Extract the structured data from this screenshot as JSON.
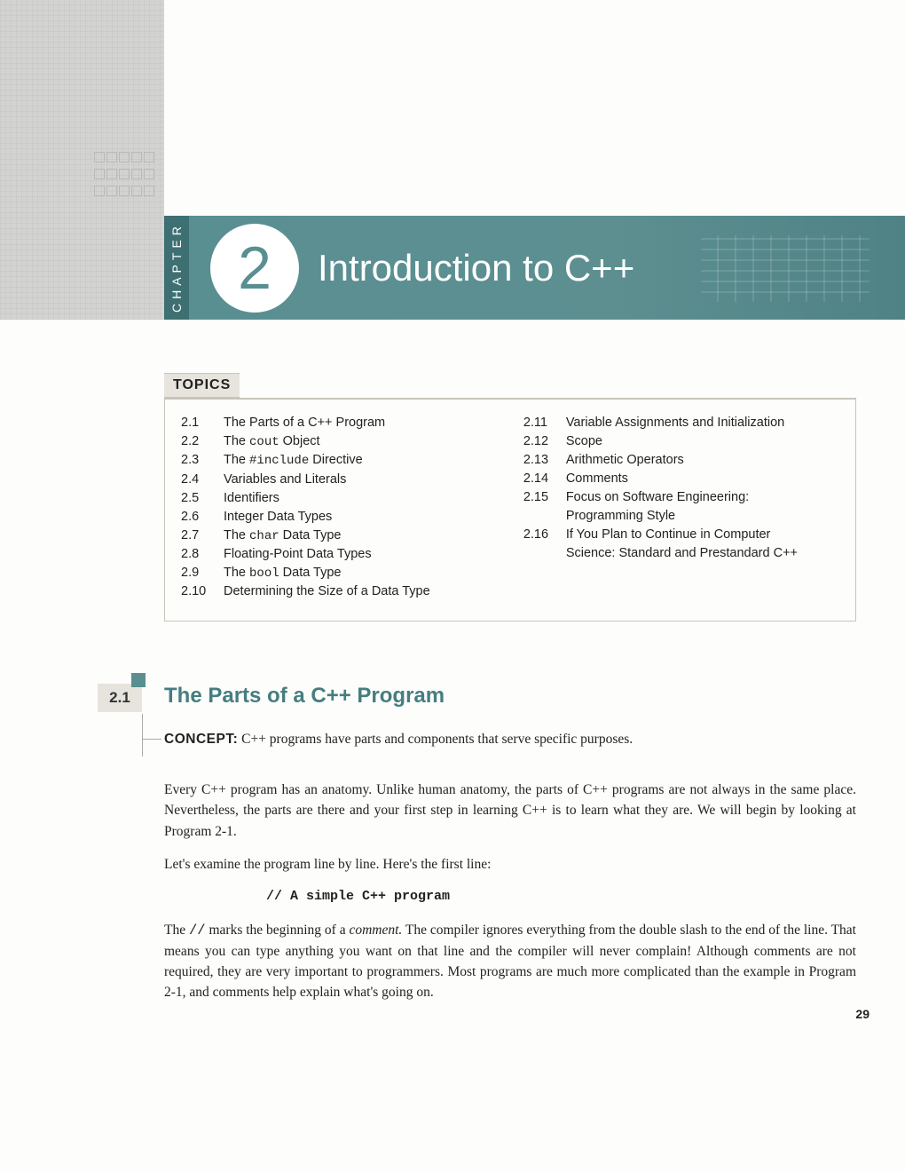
{
  "chapter_label": "CHAPTER",
  "chapter_number": "2",
  "chapter_title": "Introduction to C++",
  "topics_heading": "TOPICS",
  "topics_left": [
    {
      "num": "2.1",
      "title": "The Parts of a C++ Program"
    },
    {
      "num": "2.2",
      "title": "The cout Object",
      "code": "cout"
    },
    {
      "num": "2.3",
      "title": "The #include Directive",
      "code": "#include"
    },
    {
      "num": "2.4",
      "title": "Variables and Literals"
    },
    {
      "num": "2.5",
      "title": "Identifiers"
    },
    {
      "num": "2.6",
      "title": "Integer Data Types"
    },
    {
      "num": "2.7",
      "title": "The char Data Type",
      "code": "char"
    },
    {
      "num": "2.8",
      "title": "Floating-Point Data Types"
    },
    {
      "num": "2.9",
      "title": "The bool Data Type",
      "code": "bool"
    },
    {
      "num": "2.10",
      "title": "Determining the Size of a Data Type"
    }
  ],
  "topics_right": [
    {
      "num": "2.11",
      "title": "Variable Assignments and Initialization"
    },
    {
      "num": "2.12",
      "title": "Scope"
    },
    {
      "num": "2.13",
      "title": "Arithmetic Operators"
    },
    {
      "num": "2.14",
      "title": "Comments"
    },
    {
      "num": "2.15",
      "title": "Focus on Software Engineering: Programming Style"
    },
    {
      "num": "2.16",
      "title": "If You Plan to Continue in Computer Science: Standard and Prestandard C++"
    }
  ],
  "section": {
    "number": "2.1",
    "title": "The Parts of a C++ Program",
    "concept_label": "CONCEPT:",
    "concept_text": "C++ programs have parts and components that serve specific purposes.",
    "para1": "Every C++ program has an anatomy. Unlike human anatomy, the parts of C++ programs are not always in the same place. Nevertheless, the parts are there and your first step in learning C++ is to learn what they are. We will begin by looking at Program 2-1.",
    "para2": "Let's examine the program line by line. Here's the first line:",
    "code1": "// A simple C++ program",
    "para3_a": "The ",
    "para3_code": "//",
    "para3_b": " marks the beginning of a ",
    "para3_em": "comment.",
    "para3_c": " The compiler ignores everything from the double slash to the end of the line. That means you can type anything you want on that line and the compiler will never complain! Although comments are not required, they are very important to programmers. Most programs are much more complicated than the example in Program 2-1, and comments help explain what's going on."
  },
  "page_number": "29"
}
